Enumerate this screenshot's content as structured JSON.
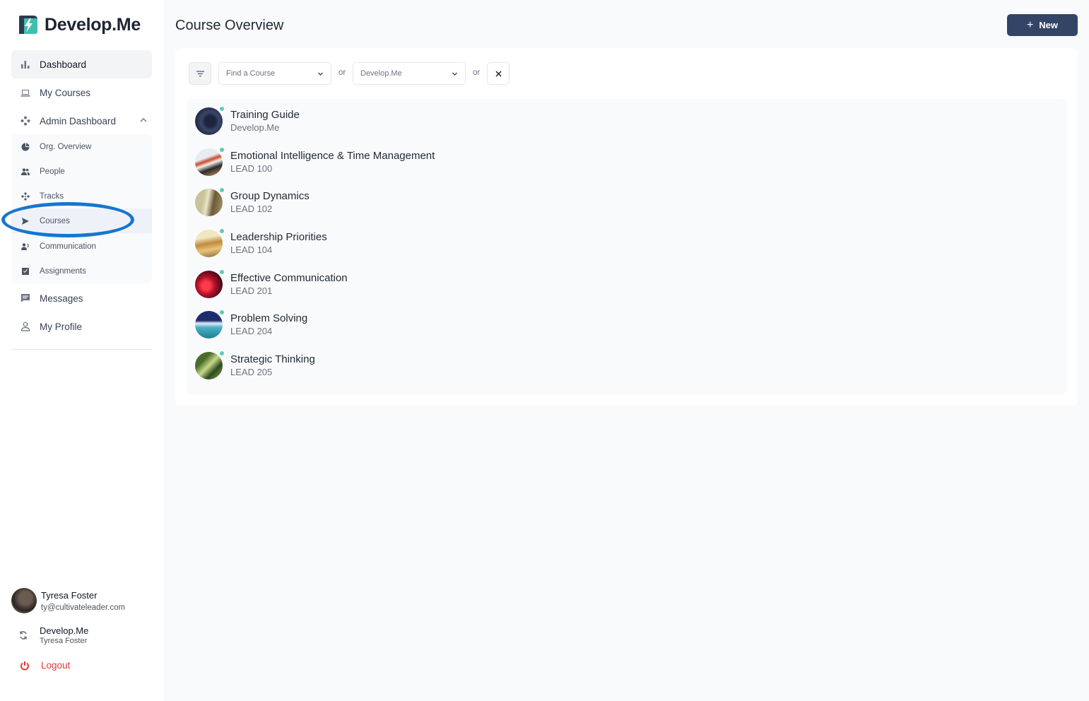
{
  "brand": {
    "name": "Develop.Me",
    "accent": "#3fbfae",
    "dark": "#2d3a4f"
  },
  "sidebar": {
    "items": [
      {
        "label": "Dashboard",
        "icon": "bar-chart-icon"
      },
      {
        "label": "My Courses",
        "icon": "laptop-icon"
      },
      {
        "label": "Admin Dashboard",
        "icon": "network-icon"
      }
    ],
    "admin_subitems": [
      {
        "label": "Org. Overview",
        "icon": "pie-chart-icon"
      },
      {
        "label": "People",
        "icon": "people-icon"
      },
      {
        "label": "Tracks",
        "icon": "tracks-icon"
      },
      {
        "label": "Courses",
        "icon": "send-icon"
      },
      {
        "label": "Communication",
        "icon": "megaphone-icon"
      },
      {
        "label": "Assignments",
        "icon": "checkbox-icon"
      }
    ],
    "lower_items": [
      {
        "label": "Messages",
        "icon": "message-icon"
      },
      {
        "label": "My Profile",
        "icon": "person-icon"
      }
    ],
    "user": {
      "name": "Tyresa Foster",
      "email": "ty@cultivateleader.com"
    },
    "org": {
      "name": "Develop.Me",
      "user": "Tyresa Foster"
    },
    "logout_label": "Logout"
  },
  "main": {
    "title": "Course Overview",
    "new_button_label": "New",
    "filters": {
      "course_placeholder": "Find a Course",
      "org_value": "Develop.Me",
      "or_label": "or"
    },
    "courses": [
      {
        "title": "Training Guide",
        "code": "Develop.Me"
      },
      {
        "title": "Emotional Intelligence & Time Management",
        "code": "LEAD 100"
      },
      {
        "title": "Group Dynamics",
        "code": "LEAD 102"
      },
      {
        "title": "Leadership Priorities",
        "code": "LEAD 104"
      },
      {
        "title": "Effective Communication",
        "code": "LEAD 201"
      },
      {
        "title": "Problem Solving",
        "code": "LEAD 204"
      },
      {
        "title": "Strategic Thinking",
        "code": "LEAD 205"
      }
    ]
  },
  "colors": {
    "primary_button": "#334466",
    "logout": "#e53935",
    "highlight_ring": "#1676cf"
  }
}
